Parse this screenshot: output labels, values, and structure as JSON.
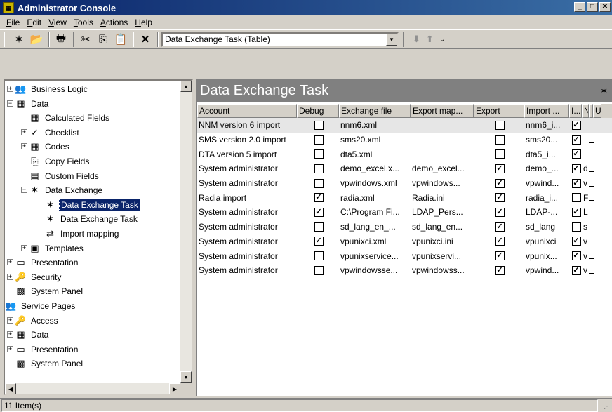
{
  "window": {
    "title": "Administrator Console"
  },
  "menu": [
    {
      "key": "F",
      "rest": "ile"
    },
    {
      "key": "E",
      "rest": "dit"
    },
    {
      "key": "V",
      "rest": "iew"
    },
    {
      "key": "T",
      "rest": "ools"
    },
    {
      "key": "A",
      "rest": "ctions"
    },
    {
      "key": "H",
      "rest": "elp"
    }
  ],
  "toolbar": {
    "combo_value": "Data Exchange Task (Table)"
  },
  "tree": [
    {
      "label": "Business Logic",
      "icon": "users-icon",
      "level": 0,
      "expander": "+"
    },
    {
      "label": "Data",
      "icon": "grid-icon",
      "level": 0,
      "expander": "-"
    },
    {
      "label": "Calculated Fields",
      "icon": "calculator-icon",
      "level": 1,
      "expander": ""
    },
    {
      "label": "Checklist",
      "icon": "checklist-icon",
      "level": 1,
      "expander": "+"
    },
    {
      "label": "Codes",
      "icon": "grid-icon",
      "level": 1,
      "expander": "+"
    },
    {
      "label": "Copy Fields",
      "icon": "copy-icon",
      "level": 1,
      "expander": ""
    },
    {
      "label": "Custom Fields",
      "icon": "custom-fields-icon",
      "level": 1,
      "expander": ""
    },
    {
      "label": "Data Exchange",
      "icon": "exchange-icon",
      "level": 1,
      "expander": "-"
    },
    {
      "label": "Data Exchange Task",
      "icon": "exchange-icon",
      "level": 2,
      "expander": "",
      "selected": true
    },
    {
      "label": "Data Exchange Task",
      "icon": "exchange-icon",
      "level": 2,
      "expander": ""
    },
    {
      "label": "Import mapping",
      "icon": "mapping-icon",
      "level": 2,
      "expander": ""
    },
    {
      "label": "Templates",
      "icon": "templates-icon",
      "level": 1,
      "expander": "+"
    },
    {
      "label": "Presentation",
      "icon": "presentation-icon",
      "level": 0,
      "expander": "+"
    },
    {
      "label": "Security",
      "icon": "security-icon",
      "level": 0,
      "expander": "+"
    },
    {
      "label": "System Panel",
      "icon": "system-panel-icon",
      "level": 0,
      "expander": ""
    },
    {
      "label": "Service Pages",
      "icon": "users-icon",
      "level": -1,
      "expander": ""
    },
    {
      "label": "Access",
      "icon": "security-icon",
      "level": 0,
      "expander": "+"
    },
    {
      "label": "Data",
      "icon": "grid-icon",
      "level": 0,
      "expander": "+"
    },
    {
      "label": "Presentation",
      "icon": "presentation-icon",
      "level": 0,
      "expander": "+"
    },
    {
      "label": "System Panel",
      "icon": "system-panel-icon",
      "level": 0,
      "expander": ""
    }
  ],
  "panel": {
    "title": "Data Exchange Task"
  },
  "table": {
    "columns": [
      "Account",
      "Debug",
      "Exchange file",
      "Export map...",
      "Export",
      "Import ...",
      "I...",
      "N",
      "F",
      "U"
    ],
    "rows": [
      {
        "account": "NNM version 6 import",
        "debug": false,
        "exchange_file": "nnm6.xml",
        "export_map": "",
        "export": false,
        "import": "nnm6_i...",
        "i": true,
        "n": ""
      },
      {
        "account": "SMS version 2.0 import",
        "debug": false,
        "exchange_file": "sms20.xml",
        "export_map": "",
        "export": false,
        "import": "sms20...",
        "i": true,
        "n": ""
      },
      {
        "account": "DTA version 5 import",
        "debug": false,
        "exchange_file": "dta5.xml",
        "export_map": "",
        "export": false,
        "import": "dta5_i...",
        "i": true,
        "n": ""
      },
      {
        "account": "System administrator",
        "debug": false,
        "exchange_file": "demo_excel.x...",
        "export_map": "demo_excel...",
        "export": true,
        "import": "demo_...",
        "i": true,
        "n": "d"
      },
      {
        "account": "System administrator",
        "debug": false,
        "exchange_file": "vpwindows.xml",
        "export_map": "vpwindows...",
        "export": true,
        "import": "vpwind...",
        "i": true,
        "n": "v"
      },
      {
        "account": "Radia import",
        "debug": true,
        "exchange_file": "radia.xml",
        "export_map": "Radia.ini",
        "export": true,
        "import": "radia_i...",
        "i": false,
        "n": "F"
      },
      {
        "account": "System administrator",
        "debug": true,
        "exchange_file": "C:\\Program Fi...",
        "export_map": "LDAP_Pers...",
        "export": true,
        "import": "LDAP-...",
        "i": true,
        "n": "L"
      },
      {
        "account": "System administrator",
        "debug": false,
        "exchange_file": "sd_lang_en_...",
        "export_map": "sd_lang_en...",
        "export": true,
        "import": "sd_lang",
        "i": false,
        "n": "s"
      },
      {
        "account": "System administrator",
        "debug": true,
        "exchange_file": "vpunixci.xml",
        "export_map": "vpunixci.ini",
        "export": true,
        "import": "vpunixci",
        "i": true,
        "n": "v"
      },
      {
        "account": "System administrator",
        "debug": false,
        "exchange_file": "vpunixservice...",
        "export_map": "vpunixservi...",
        "export": true,
        "import": "vpunix...",
        "i": true,
        "n": "v"
      },
      {
        "account": "System administrator",
        "debug": false,
        "exchange_file": "vpwindowsse...",
        "export_map": "vpwindowss...",
        "export": true,
        "import": "vpwind...",
        "i": true,
        "n": "v"
      }
    ]
  },
  "status": {
    "text": "11 Item(s)"
  }
}
